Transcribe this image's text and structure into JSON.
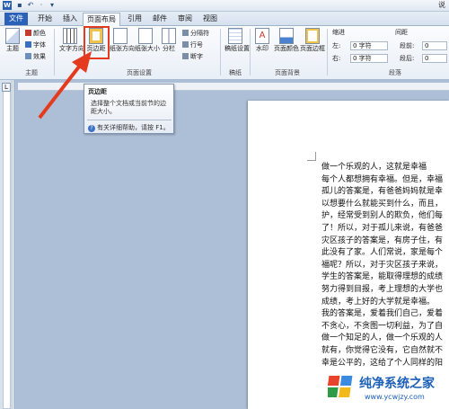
{
  "title_right": "说",
  "tabs": {
    "file": "文件",
    "items": [
      "开始",
      "插入",
      "页面布局",
      "引用",
      "邮件",
      "审阅",
      "视图"
    ],
    "active": "页面布局"
  },
  "ribbon": {
    "theme_group": {
      "label": "主题",
      "theme_button": "主题",
      "colors": "颜色",
      "fonts": "字体",
      "effects": "效果"
    },
    "page_setup": {
      "label": "页面设置",
      "text_direction": "文字方向",
      "margins": "页边距",
      "orientation": "纸张方向",
      "size": "纸张大小",
      "columns": "分栏",
      "breaks": "分隔符",
      "line_numbers": "行号",
      "hyphenation": "断字"
    },
    "draft": {
      "label": "稿纸",
      "settings": "稿纸设置"
    },
    "page_background": {
      "label": "页面背景",
      "watermark": "水印",
      "page_color": "页面颜色",
      "page_borders": "页面边框"
    },
    "paragraph": {
      "label": "段落",
      "indent": "缩进",
      "spacing": "间距",
      "left": "左:",
      "right": "右:",
      "left_value": "0 字符",
      "right_value": "0 字符",
      "before": "段前:",
      "after": "段后:",
      "before_value": "0",
      "after_value": "0"
    }
  },
  "tooltip": {
    "title": "页边距",
    "body": "选择整个文档或当前节的边距大小。",
    "help": "有关详细帮助，请按 F1。"
  },
  "document": {
    "lines": [
      "做一个乐观的人，这就是幸福",
      "每个人都想拥有幸福。但是，幸福",
      "孤儿的答案是，有爸爸妈妈就是幸",
      "以想要什么就能买到什么，而且，",
      "护，经常受到别人的欺负，他们每",
      "了！所以，对于孤儿来说，有爸爸",
      "灾区孩子的答案是，有房子住，有",
      "此没有了家。人们常说，家是每个",
      "福呢？所以，对于灾区孩子来说，",
      "学生的答案是，能取得理想的成绩",
      "努力得到目报，考上理想的大学也",
      "成绩，考上好的大学就是幸福。",
      "我的答案是，爱着我们自己，爱着",
      "不贪心，不贪图一切利益，为了自",
      "做一个知足的人，做一个乐观的人",
      "就有，你觉得它没有，它自然就不",
      "幸是公平的，这给了个人同样的阳"
    ]
  },
  "watermark": {
    "name": "纯净系统之家",
    "url": "www.ycwjzy.com"
  },
  "colors": {
    "accent": "#2b62b8",
    "highlight": "#e43b1e"
  }
}
